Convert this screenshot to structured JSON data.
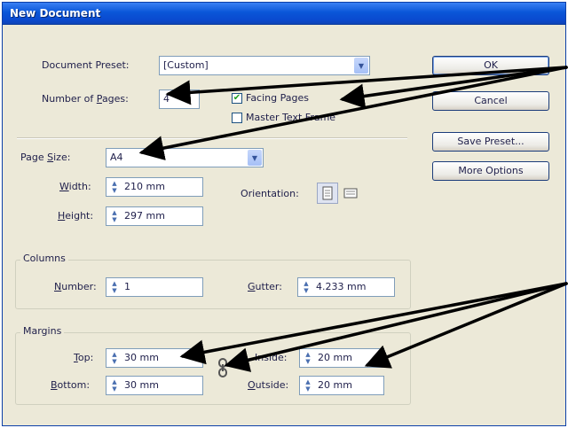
{
  "window": {
    "title": "New Document"
  },
  "document_preset": {
    "label": "Document Preset:",
    "value": "[Custom]"
  },
  "number_of_pages": {
    "label_pre": "Number of ",
    "label_ul": "P",
    "label_post": "ages:",
    "value": "4"
  },
  "facing_pages": {
    "label": "Facing Pages",
    "checked": true
  },
  "master_text_frame": {
    "label": "Master Text Frame",
    "checked": false
  },
  "page_size": {
    "label_pre": "Page ",
    "label_ul": "S",
    "label_post": "ize:",
    "value": "A4"
  },
  "width": {
    "label_ul": "W",
    "label_post": "idth:",
    "value": "210 mm"
  },
  "height": {
    "label_ul": "H",
    "label_post": "eight:",
    "value": "297 mm"
  },
  "orientation": {
    "label": "Orientation:",
    "selected": "portrait"
  },
  "columns": {
    "group_label": "Columns",
    "number": {
      "label_ul": "N",
      "label_post": "umber:",
      "value": "1"
    },
    "gutter": {
      "label_ul": "G",
      "label_post": "utter:",
      "value": "4.233 mm"
    }
  },
  "margins": {
    "group_label": "Margins",
    "top": {
      "label_ul": "T",
      "label_post": "op:",
      "value": "30 mm"
    },
    "bottom": {
      "label_ul": "B",
      "label_post": "ottom:",
      "value": "30 mm"
    },
    "inside": {
      "label": "Inside:",
      "value": "20 mm"
    },
    "outside": {
      "label_ul": "O",
      "label_post": "utside:",
      "value": "20 mm"
    },
    "link_icon": "chain-link-icon"
  },
  "buttons": {
    "ok": "OK",
    "cancel": "Cancel",
    "save_preset": "Save Preset...",
    "more_options": "More Options"
  },
  "colors": {
    "titlebar": "#0a56d8",
    "dialog_bg": "#ece9d8",
    "annotation_arrow": "#000000"
  }
}
